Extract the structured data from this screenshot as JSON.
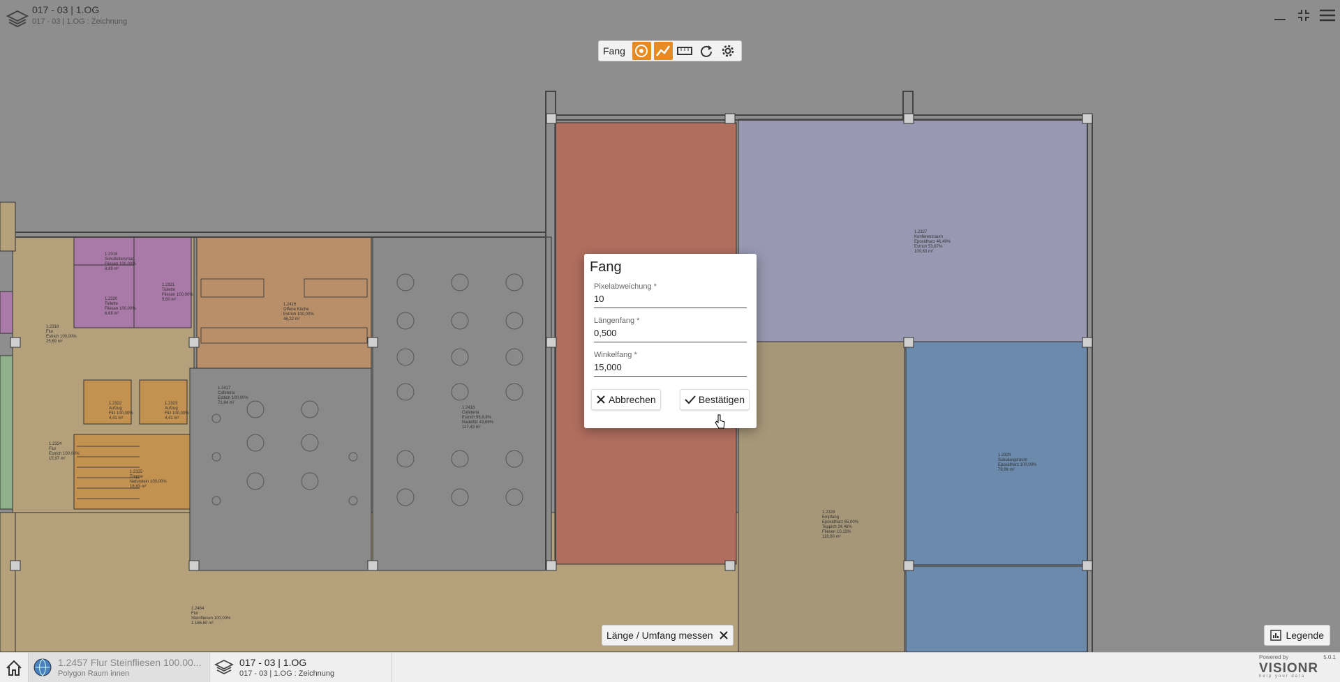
{
  "header": {
    "title": "017 - 03 | 1.OG",
    "subtitle": "017 - 03 | 1.OG : Zeichnung",
    "layers_icon": "layers-icon",
    "minimize_icon": "minimize-icon",
    "collapse_icon": "collapse-icon",
    "menu_icon": "hamburger-menu-icon"
  },
  "snap_toolbar": {
    "label": "Fang",
    "buttons": [
      "target-snap-icon",
      "polyline-snap-icon",
      "ruler-icon",
      "rotate-icon",
      "gear-icon"
    ],
    "active_color": "#e68a24"
  },
  "dialog": {
    "title": "Fang",
    "fields": [
      {
        "label": "Pixelabweichung *",
        "value": "10"
      },
      {
        "label": "Längenfang *",
        "value": "0,500"
      },
      {
        "label": "Winkelfang *",
        "value": "15,000"
      }
    ],
    "cancel_label": "Abbrechen",
    "confirm_label": "Bestätigen"
  },
  "measure_chip": {
    "label": "Länge / Umfang messen"
  },
  "legend_button": {
    "label": "Legende"
  },
  "bottombar": {
    "item1_title": "1.2457 Flur Steinfliesen 100.00...",
    "item1_sub": "Polygon Raum innen",
    "item2_title": "017 - 03 | 1.OG",
    "item2_sub": "017 - 03 | 1.OG : Zeichnung",
    "powered_by": "Powered by",
    "version": "5.0.1",
    "logo": "VISIONR",
    "logo_tag": "help your data"
  },
  "rooms": {
    "r2319": [
      "1.2319",
      "Schulleitersmag.",
      "Fliesen 100,00%",
      "8,89 m²"
    ],
    "r2320": [
      "1.2320",
      "Toilette",
      "Fliesen 100,00%",
      "6,68 m²"
    ],
    "r2321": [
      "1.2321",
      "Toilette",
      "Fliesen 100,00%",
      "9,60 m²"
    ],
    "r2318": [
      "1.2318",
      "Flur",
      "Estrich 100,00%",
      "25,69 m²"
    ],
    "r2416": [
      "1.2416",
      "Offene Küche",
      "Estrich 100,00%",
      "46,22 m²"
    ],
    "r2417": [
      "1.2417",
      "Cafeteria",
      "Estrich 100,00%",
      "71,84 m²"
    ],
    "r2418": [
      "1.2418",
      "Cafeteria",
      "Estrich 56,8,8%",
      "Nadelfilz 43,69%",
      "117,43 m²"
    ],
    "r2322": [
      "1.2322",
      "Aufzug",
      "Fliz 100,00%",
      "4,41 m²"
    ],
    "r2323": [
      "1.2323",
      "Aufzug",
      "Fliz 100,00%",
      "4,41 m²"
    ],
    "r2324": [
      "1.2324",
      "Flur",
      "Estrich 100,00%",
      "15,97 m²"
    ],
    "r2325": [
      "1.2325",
      "Treppe",
      "Naturstein 100,00%",
      "16,83 m²"
    ],
    "r2327": [
      "1.2327",
      "Konferenzraum",
      "Epoxidharz 46,49%",
      "Estrich 53,67%",
      "100,63 m²"
    ],
    "r2329": [
      "1.2329",
      "Schulungsraum",
      "Epoxidharz 100,00%",
      "79,96 m²"
    ],
    "r2328": [
      "1.2328",
      "Empfang",
      "Epoxidharz 65,00%",
      "Teppich 24,46%",
      "Fliesen 10,13%",
      "116,60 m²"
    ],
    "r2464": [
      "1.2464",
      "Flur",
      "Steinfliesen 100,00%",
      "1.166,60 m²"
    ]
  }
}
